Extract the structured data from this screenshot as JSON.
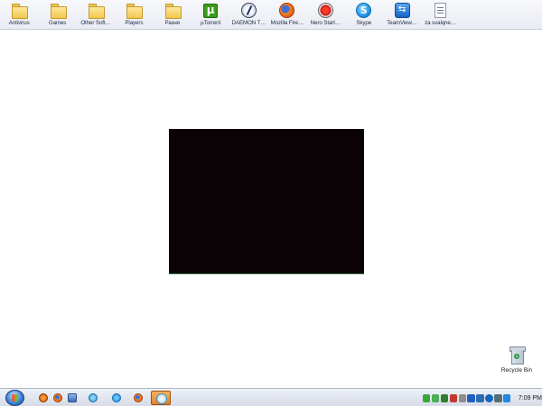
{
  "top_shortcuts": [
    {
      "label": "Antivirus",
      "icon": "folder-icon"
    },
    {
      "label": "Games",
      "icon": "folder-icon"
    },
    {
      "label": "Other Soft…",
      "icon": "folder-icon"
    },
    {
      "label": "Players",
      "icon": "folder-icon"
    },
    {
      "label": "Разни",
      "icon": "folder-icon"
    },
    {
      "label": "µTorrent",
      "icon": "utorrent-icon"
    },
    {
      "label": "DAEMON T…",
      "icon": "daemon-tools-icon"
    },
    {
      "label": "Mozilla Fire…",
      "icon": "firefox-icon"
    },
    {
      "label": "Nero Start…",
      "icon": "nero-icon"
    },
    {
      "label": "Skype",
      "icon": "skype-icon"
    },
    {
      "label": "TeamView…",
      "icon": "teamviewer-icon"
    },
    {
      "label": "za svalqne…",
      "icon": "document-icon"
    }
  ],
  "desktop": {
    "recycle_bin_label": "Recycle Bin",
    "video_window_color": "#0b0205"
  },
  "taskbar": {
    "clock": "7:09 PM",
    "start_icon": "start-orb-icon",
    "quick_launch_icons": [
      "orange-app-icon",
      "firefox-icon",
      "window-app-icon",
      "teamviewer-icon",
      "skype-icon",
      "firefox-icon"
    ],
    "active_task_icon": "media-player-icon",
    "tray_colors": [
      "#3aa53a",
      "#4caf50",
      "#2e7d32",
      "#c0392b",
      "#8e8e8e",
      "#1f5fbf",
      "#2b6cb0",
      "#1565c0",
      "#546e7a",
      "#1e88e5"
    ]
  }
}
